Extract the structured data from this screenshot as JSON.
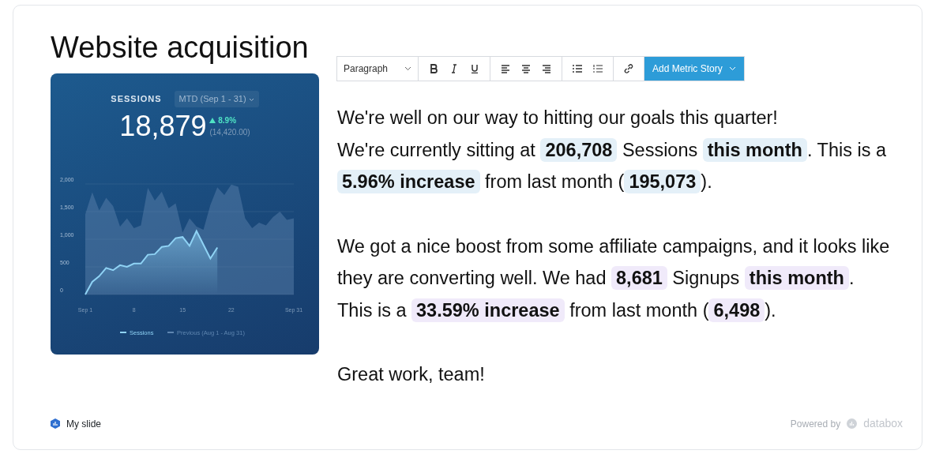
{
  "title": "Website acquisition",
  "widget": {
    "metric": "SESSIONS",
    "range": "MTD (Sep 1 - 31)",
    "value": "18,879",
    "change": "8.9%",
    "previous": "(14,420.00)",
    "chart_data": {
      "type": "area",
      "x": [
        1,
        2,
        3,
        4,
        5,
        6,
        7,
        8,
        9,
        10,
        11,
        12,
        13,
        14,
        15,
        16,
        17,
        18,
        19,
        20,
        21,
        22,
        23,
        24,
        25,
        26,
        27,
        28,
        29,
        30,
        31
      ],
      "xticks": [
        {
          "value": 1,
          "label": "Sep 1"
        },
        {
          "value": 8,
          "label": "8"
        },
        {
          "value": 15,
          "label": "15"
        },
        {
          "value": 22,
          "label": "22"
        },
        {
          "value": 31,
          "label": "Sep 31"
        }
      ],
      "yticks": [
        {
          "value": 0,
          "label": "0"
        },
        {
          "value": 500,
          "label": "500"
        },
        {
          "value": 1000,
          "label": "1,000"
        },
        {
          "value": 1500,
          "label": "1,500"
        },
        {
          "value": 2000,
          "label": "2,000"
        }
      ],
      "ylim": [
        0,
        2000
      ],
      "xlim": [
        1,
        31
      ],
      "grid": true,
      "legend": true,
      "series": [
        {
          "name": "Sessions",
          "color": "#8fd3f5",
          "values": [
            0,
            230,
            330,
            480,
            440,
            530,
            500,
            560,
            560,
            720,
            730,
            860,
            880,
            1020,
            1040,
            880,
            1150,
            900,
            650,
            850,
            null,
            null,
            null,
            null,
            null,
            null,
            null,
            null,
            null,
            null,
            null
          ]
        },
        {
          "name": "Previous (Aug 1 - Aug 31)",
          "color": "#5f86b0",
          "values": [
            1450,
            1850,
            1520,
            1750,
            1600,
            1230,
            1380,
            1200,
            1250,
            1930,
            1700,
            1860,
            1560,
            1650,
            1120,
            1380,
            1230,
            1170,
            1620,
            1940,
            1800,
            1990,
            1950,
            1380,
            1200,
            1300,
            1250,
            1400,
            1500,
            1350,
            1380
          ]
        }
      ]
    }
  },
  "toolbar": {
    "style": "Paragraph",
    "action": "Add Metric Story"
  },
  "paragraphs": [
    [
      {
        "kind": "text",
        "text": "We're well on our way to hitting our goals this quarter!"
      },
      {
        "kind": "break"
      },
      {
        "kind": "text",
        "text": "We're currently sitting at "
      },
      {
        "kind": "metric",
        "text": "206,708",
        "color": "#e4f0f8"
      },
      {
        "kind": "text",
        "text": " Sessions "
      },
      {
        "kind": "metric",
        "text": "this month",
        "color": "#e4f0f8"
      },
      {
        "kind": "text",
        "text": ". This is a "
      },
      {
        "kind": "metric",
        "text": "5.96% increase",
        "color": "#e4f0f8"
      },
      {
        "kind": "text",
        "text": " from last month ("
      },
      {
        "kind": "metric",
        "text": "195,073",
        "color": "#e4f0f8"
      },
      {
        "kind": "text",
        "text": ")."
      }
    ],
    [
      {
        "kind": "text",
        "text": "We got a nice boost from some affiliate campaigns, and it looks like they are converting well. We had "
      },
      {
        "kind": "metric",
        "text": "8,681",
        "color": "#f0eafa"
      },
      {
        "kind": "text",
        "text": " Signups "
      },
      {
        "kind": "metric",
        "text": "this month",
        "color": "#f0eafa"
      },
      {
        "kind": "text",
        "text": "."
      },
      {
        "kind": "break"
      },
      {
        "kind": "text",
        "text": "This is a "
      },
      {
        "kind": "metric",
        "text": "33.59% increase",
        "color": "#f0eafa"
      },
      {
        "kind": "text",
        "text": " from last month ("
      },
      {
        "kind": "metric",
        "text": "6,498",
        "color": "#f0eafa"
      },
      {
        "kind": "text",
        "text": ")."
      }
    ],
    [
      {
        "kind": "text",
        "text": "Great work, team!"
      }
    ]
  ],
  "footer": {
    "slide": "My slide",
    "powered": "Powered by",
    "brand": "databox"
  }
}
